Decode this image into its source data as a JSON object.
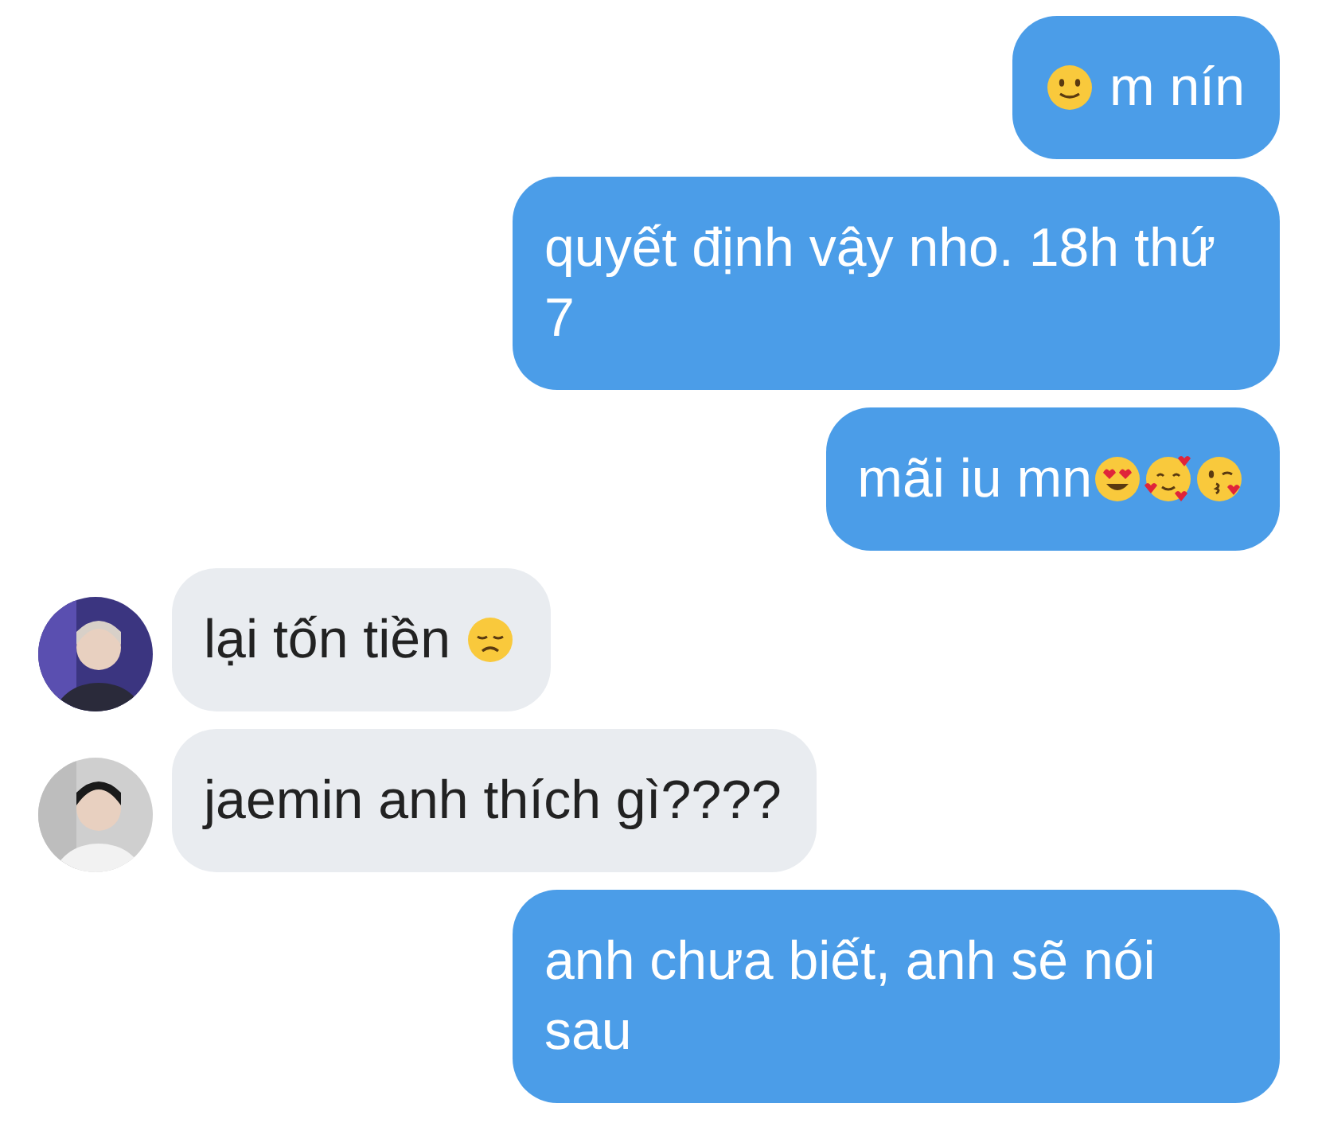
{
  "messages": [
    {
      "kind": "outgoing",
      "parts": [
        {
          "kind": "smile-emoji"
        },
        {
          "kind": "text",
          "text": " m nín"
        }
      ]
    },
    {
      "kind": "outgoing",
      "parts": [
        {
          "kind": "text",
          "text": "quyết định vậy nho. 18h thứ 7"
        }
      ]
    },
    {
      "kind": "outgoing",
      "parts": [
        {
          "kind": "text",
          "text": "mãi iu mn"
        },
        {
          "kind": "heart-eyes-emoji"
        },
        {
          "kind": "hearts-emoji"
        },
        {
          "kind": "kiss-emoji"
        }
      ]
    },
    {
      "kind": "incoming",
      "avatar": {
        "kind": "picture"
      },
      "parts": [
        {
          "kind": "text",
          "text": "lại tốn tiền "
        },
        {
          "kind": "sad-emoji"
        }
      ]
    },
    {
      "kind": "incoming",
      "avatar": {
        "kind": "picture"
      },
      "parts": [
        {
          "kind": "text",
          "text": "jaemin anh thích gì????"
        }
      ]
    },
    {
      "kind": "outgoing",
      "parts": [
        {
          "kind": "text",
          "text": "anh chưa biết, anh sẽ nói sau"
        }
      ]
    }
  ]
}
